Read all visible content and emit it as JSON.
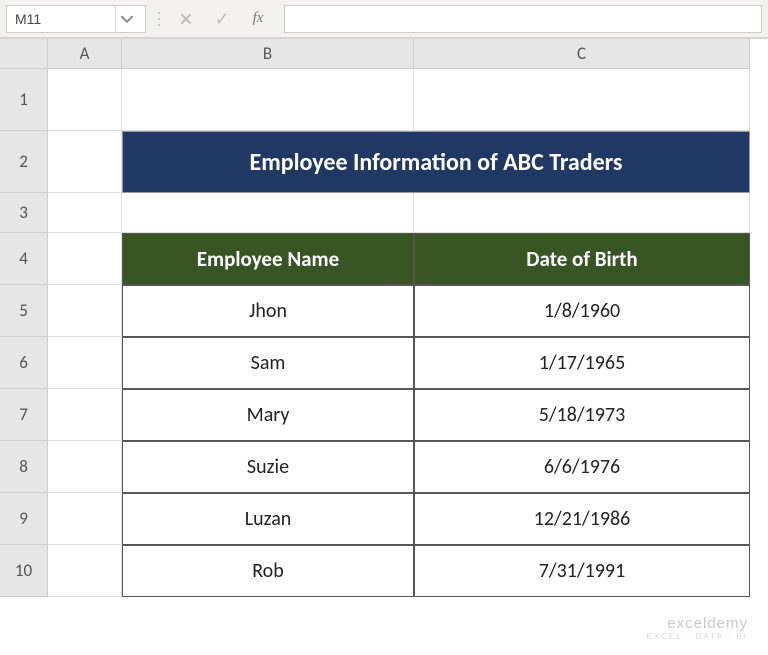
{
  "formula_bar": {
    "cell_ref": "M11",
    "fx_label": "fx",
    "formula": ""
  },
  "columns": [
    "A",
    "B",
    "C"
  ],
  "rows": [
    "1",
    "2",
    "3",
    "4",
    "5",
    "6",
    "7",
    "8",
    "9",
    "10"
  ],
  "title": "Employee Information of ABC Traders",
  "table": {
    "headers": {
      "name": "Employee Name",
      "dob": "Date of Birth"
    },
    "rows": [
      {
        "name": "Jhon",
        "dob": "1/8/1960"
      },
      {
        "name": "Sam",
        "dob": "1/17/1965"
      },
      {
        "name": "Mary",
        "dob": "5/18/1973"
      },
      {
        "name": "Suzie",
        "dob": "6/6/1976"
      },
      {
        "name": "Luzan",
        "dob": "12/21/1986"
      },
      {
        "name": "Rob",
        "dob": "7/31/1991"
      }
    ]
  },
  "watermark": {
    "main": "exceldemy",
    "sub": "EXCEL · DATA · BI"
  }
}
